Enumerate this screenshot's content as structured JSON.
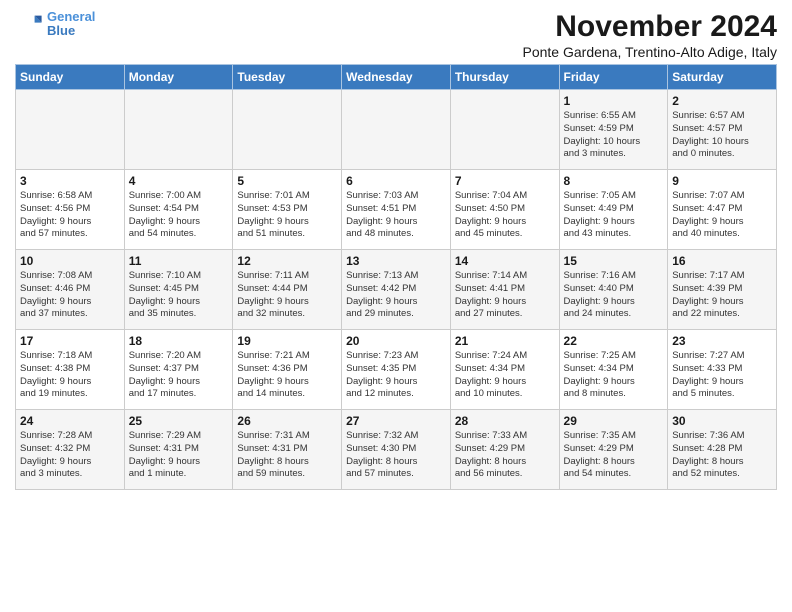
{
  "logo": {
    "line1": "General",
    "line2": "Blue"
  },
  "title": "November 2024",
  "location": "Ponte Gardena, Trentino-Alto Adige, Italy",
  "weekdays": [
    "Sunday",
    "Monday",
    "Tuesday",
    "Wednesday",
    "Thursday",
    "Friday",
    "Saturday"
  ],
  "weeks": [
    [
      {
        "day": "",
        "info": ""
      },
      {
        "day": "",
        "info": ""
      },
      {
        "day": "",
        "info": ""
      },
      {
        "day": "",
        "info": ""
      },
      {
        "day": "",
        "info": ""
      },
      {
        "day": "1",
        "info": "Sunrise: 6:55 AM\nSunset: 4:59 PM\nDaylight: 10 hours\nand 3 minutes."
      },
      {
        "day": "2",
        "info": "Sunrise: 6:57 AM\nSunset: 4:57 PM\nDaylight: 10 hours\nand 0 minutes."
      }
    ],
    [
      {
        "day": "3",
        "info": "Sunrise: 6:58 AM\nSunset: 4:56 PM\nDaylight: 9 hours\nand 57 minutes."
      },
      {
        "day": "4",
        "info": "Sunrise: 7:00 AM\nSunset: 4:54 PM\nDaylight: 9 hours\nand 54 minutes."
      },
      {
        "day": "5",
        "info": "Sunrise: 7:01 AM\nSunset: 4:53 PM\nDaylight: 9 hours\nand 51 minutes."
      },
      {
        "day": "6",
        "info": "Sunrise: 7:03 AM\nSunset: 4:51 PM\nDaylight: 9 hours\nand 48 minutes."
      },
      {
        "day": "7",
        "info": "Sunrise: 7:04 AM\nSunset: 4:50 PM\nDaylight: 9 hours\nand 45 minutes."
      },
      {
        "day": "8",
        "info": "Sunrise: 7:05 AM\nSunset: 4:49 PM\nDaylight: 9 hours\nand 43 minutes."
      },
      {
        "day": "9",
        "info": "Sunrise: 7:07 AM\nSunset: 4:47 PM\nDaylight: 9 hours\nand 40 minutes."
      }
    ],
    [
      {
        "day": "10",
        "info": "Sunrise: 7:08 AM\nSunset: 4:46 PM\nDaylight: 9 hours\nand 37 minutes."
      },
      {
        "day": "11",
        "info": "Sunrise: 7:10 AM\nSunset: 4:45 PM\nDaylight: 9 hours\nand 35 minutes."
      },
      {
        "day": "12",
        "info": "Sunrise: 7:11 AM\nSunset: 4:44 PM\nDaylight: 9 hours\nand 32 minutes."
      },
      {
        "day": "13",
        "info": "Sunrise: 7:13 AM\nSunset: 4:42 PM\nDaylight: 9 hours\nand 29 minutes."
      },
      {
        "day": "14",
        "info": "Sunrise: 7:14 AM\nSunset: 4:41 PM\nDaylight: 9 hours\nand 27 minutes."
      },
      {
        "day": "15",
        "info": "Sunrise: 7:16 AM\nSunset: 4:40 PM\nDaylight: 9 hours\nand 24 minutes."
      },
      {
        "day": "16",
        "info": "Sunrise: 7:17 AM\nSunset: 4:39 PM\nDaylight: 9 hours\nand 22 minutes."
      }
    ],
    [
      {
        "day": "17",
        "info": "Sunrise: 7:18 AM\nSunset: 4:38 PM\nDaylight: 9 hours\nand 19 minutes."
      },
      {
        "day": "18",
        "info": "Sunrise: 7:20 AM\nSunset: 4:37 PM\nDaylight: 9 hours\nand 17 minutes."
      },
      {
        "day": "19",
        "info": "Sunrise: 7:21 AM\nSunset: 4:36 PM\nDaylight: 9 hours\nand 14 minutes."
      },
      {
        "day": "20",
        "info": "Sunrise: 7:23 AM\nSunset: 4:35 PM\nDaylight: 9 hours\nand 12 minutes."
      },
      {
        "day": "21",
        "info": "Sunrise: 7:24 AM\nSunset: 4:34 PM\nDaylight: 9 hours\nand 10 minutes."
      },
      {
        "day": "22",
        "info": "Sunrise: 7:25 AM\nSunset: 4:34 PM\nDaylight: 9 hours\nand 8 minutes."
      },
      {
        "day": "23",
        "info": "Sunrise: 7:27 AM\nSunset: 4:33 PM\nDaylight: 9 hours\nand 5 minutes."
      }
    ],
    [
      {
        "day": "24",
        "info": "Sunrise: 7:28 AM\nSunset: 4:32 PM\nDaylight: 9 hours\nand 3 minutes."
      },
      {
        "day": "25",
        "info": "Sunrise: 7:29 AM\nSunset: 4:31 PM\nDaylight: 9 hours\nand 1 minute."
      },
      {
        "day": "26",
        "info": "Sunrise: 7:31 AM\nSunset: 4:31 PM\nDaylight: 8 hours\nand 59 minutes."
      },
      {
        "day": "27",
        "info": "Sunrise: 7:32 AM\nSunset: 4:30 PM\nDaylight: 8 hours\nand 57 minutes."
      },
      {
        "day": "28",
        "info": "Sunrise: 7:33 AM\nSunset: 4:29 PM\nDaylight: 8 hours\nand 56 minutes."
      },
      {
        "day": "29",
        "info": "Sunrise: 7:35 AM\nSunset: 4:29 PM\nDaylight: 8 hours\nand 54 minutes."
      },
      {
        "day": "30",
        "info": "Sunrise: 7:36 AM\nSunset: 4:28 PM\nDaylight: 8 hours\nand 52 minutes."
      }
    ]
  ]
}
